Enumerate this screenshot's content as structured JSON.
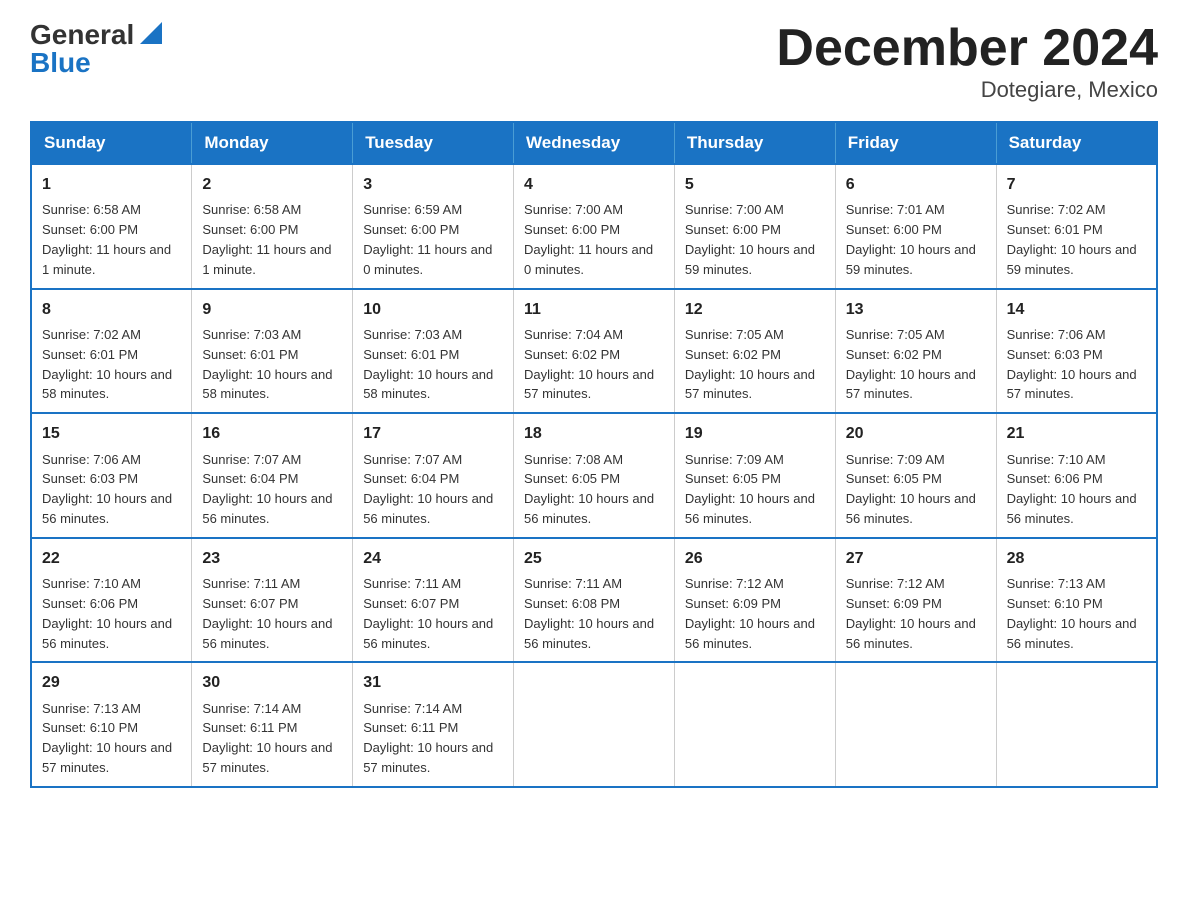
{
  "logo": {
    "general": "General",
    "blue": "Blue"
  },
  "title": "December 2024",
  "subtitle": "Dotegiare, Mexico",
  "days": [
    "Sunday",
    "Monday",
    "Tuesday",
    "Wednesday",
    "Thursday",
    "Friday",
    "Saturday"
  ],
  "weeks": [
    [
      {
        "num": "1",
        "sunrise": "6:58 AM",
        "sunset": "6:00 PM",
        "daylight": "11 hours and 1 minute."
      },
      {
        "num": "2",
        "sunrise": "6:58 AM",
        "sunset": "6:00 PM",
        "daylight": "11 hours and 1 minute."
      },
      {
        "num": "3",
        "sunrise": "6:59 AM",
        "sunset": "6:00 PM",
        "daylight": "11 hours and 0 minutes."
      },
      {
        "num": "4",
        "sunrise": "7:00 AM",
        "sunset": "6:00 PM",
        "daylight": "11 hours and 0 minutes."
      },
      {
        "num": "5",
        "sunrise": "7:00 AM",
        "sunset": "6:00 PM",
        "daylight": "10 hours and 59 minutes."
      },
      {
        "num": "6",
        "sunrise": "7:01 AM",
        "sunset": "6:00 PM",
        "daylight": "10 hours and 59 minutes."
      },
      {
        "num": "7",
        "sunrise": "7:02 AM",
        "sunset": "6:01 PM",
        "daylight": "10 hours and 59 minutes."
      }
    ],
    [
      {
        "num": "8",
        "sunrise": "7:02 AM",
        "sunset": "6:01 PM",
        "daylight": "10 hours and 58 minutes."
      },
      {
        "num": "9",
        "sunrise": "7:03 AM",
        "sunset": "6:01 PM",
        "daylight": "10 hours and 58 minutes."
      },
      {
        "num": "10",
        "sunrise": "7:03 AM",
        "sunset": "6:01 PM",
        "daylight": "10 hours and 58 minutes."
      },
      {
        "num": "11",
        "sunrise": "7:04 AM",
        "sunset": "6:02 PM",
        "daylight": "10 hours and 57 minutes."
      },
      {
        "num": "12",
        "sunrise": "7:05 AM",
        "sunset": "6:02 PM",
        "daylight": "10 hours and 57 minutes."
      },
      {
        "num": "13",
        "sunrise": "7:05 AM",
        "sunset": "6:02 PM",
        "daylight": "10 hours and 57 minutes."
      },
      {
        "num": "14",
        "sunrise": "7:06 AM",
        "sunset": "6:03 PM",
        "daylight": "10 hours and 57 minutes."
      }
    ],
    [
      {
        "num": "15",
        "sunrise": "7:06 AM",
        "sunset": "6:03 PM",
        "daylight": "10 hours and 56 minutes."
      },
      {
        "num": "16",
        "sunrise": "7:07 AM",
        "sunset": "6:04 PM",
        "daylight": "10 hours and 56 minutes."
      },
      {
        "num": "17",
        "sunrise": "7:07 AM",
        "sunset": "6:04 PM",
        "daylight": "10 hours and 56 minutes."
      },
      {
        "num": "18",
        "sunrise": "7:08 AM",
        "sunset": "6:05 PM",
        "daylight": "10 hours and 56 minutes."
      },
      {
        "num": "19",
        "sunrise": "7:09 AM",
        "sunset": "6:05 PM",
        "daylight": "10 hours and 56 minutes."
      },
      {
        "num": "20",
        "sunrise": "7:09 AM",
        "sunset": "6:05 PM",
        "daylight": "10 hours and 56 minutes."
      },
      {
        "num": "21",
        "sunrise": "7:10 AM",
        "sunset": "6:06 PM",
        "daylight": "10 hours and 56 minutes."
      }
    ],
    [
      {
        "num": "22",
        "sunrise": "7:10 AM",
        "sunset": "6:06 PM",
        "daylight": "10 hours and 56 minutes."
      },
      {
        "num": "23",
        "sunrise": "7:11 AM",
        "sunset": "6:07 PM",
        "daylight": "10 hours and 56 minutes."
      },
      {
        "num": "24",
        "sunrise": "7:11 AM",
        "sunset": "6:07 PM",
        "daylight": "10 hours and 56 minutes."
      },
      {
        "num": "25",
        "sunrise": "7:11 AM",
        "sunset": "6:08 PM",
        "daylight": "10 hours and 56 minutes."
      },
      {
        "num": "26",
        "sunrise": "7:12 AM",
        "sunset": "6:09 PM",
        "daylight": "10 hours and 56 minutes."
      },
      {
        "num": "27",
        "sunrise": "7:12 AM",
        "sunset": "6:09 PM",
        "daylight": "10 hours and 56 minutes."
      },
      {
        "num": "28",
        "sunrise": "7:13 AM",
        "sunset": "6:10 PM",
        "daylight": "10 hours and 56 minutes."
      }
    ],
    [
      {
        "num": "29",
        "sunrise": "7:13 AM",
        "sunset": "6:10 PM",
        "daylight": "10 hours and 57 minutes."
      },
      {
        "num": "30",
        "sunrise": "7:14 AM",
        "sunset": "6:11 PM",
        "daylight": "10 hours and 57 minutes."
      },
      {
        "num": "31",
        "sunrise": "7:14 AM",
        "sunset": "6:11 PM",
        "daylight": "10 hours and 57 minutes."
      },
      null,
      null,
      null,
      null
    ]
  ]
}
